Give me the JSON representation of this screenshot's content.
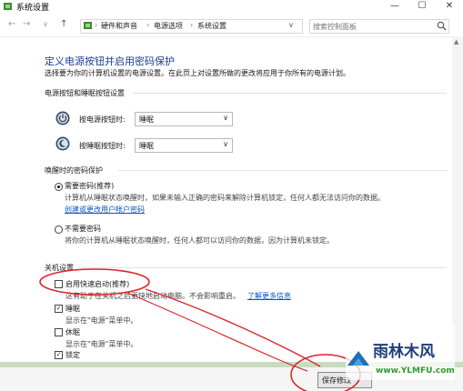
{
  "window": {
    "title": "系统设置",
    "minimize": "—",
    "maximize": "☐",
    "close": "✕"
  },
  "nav": {
    "back": "←",
    "forward": "→",
    "down": "∨",
    "up": "↑",
    "breadcrumbs": [
      "硬件和声音",
      "电源选项",
      "系统设置"
    ],
    "sep": "›",
    "chevron_end": "∨"
  },
  "search": {
    "placeholder": "搜索控制面板"
  },
  "main": {
    "title": "定义电源按钮并启用密码保护",
    "description": "选择要为你的计算机设置的电源设置。在此页上对设置所做的更改将应用于你所有的电源计划。",
    "power_section": {
      "header": "电源按钮和睡眠按钮设置",
      "power_button_label": "按电源按钮时:",
      "power_button_value": "睡眠",
      "sleep_button_label": "按睡眠按钮时:",
      "sleep_button_value": "睡眠"
    },
    "password_section": {
      "header": "唤醒时的密码保护",
      "require_label": "需要密码(推荐)",
      "require_desc": "计算机从睡眠状态唤醒时，如果未输入正确的密码来解除计算机锁定，任何人都无法访问你的数据。",
      "require_link": "创建或更改用户帐户密码",
      "norequire_label": "不需要密码",
      "norequire_desc": "将你的计算机从睡眠状态唤醒时，任何人都可以访问你的数据，因为计算机未锁定。"
    },
    "shutdown_section": {
      "header": "关机设置",
      "fast_startup_label": "启用快速启动(推荐)",
      "fast_startup_desc": "这有助于在关机之后更快地启动电脑。不会影响重启。",
      "fast_startup_link": "了解更多信息",
      "sleep_label": "睡眠",
      "sleep_desc": "显示在\"电源\"菜单中。",
      "hibernate_label": "休眠",
      "hibernate_desc": "显示在\"电源\"菜单中。",
      "lock_label": "锁定",
      "checkmark": "✓"
    }
  },
  "footer": {
    "save_label": "保存修改"
  },
  "watermark": {
    "line1": "雨林木风",
    "line2": "www.YLMFU.com"
  },
  "colors": {
    "title_blue": "#1e3d8f",
    "link_blue": "#0a55c4",
    "annotation_red": "#d9262c",
    "green_bar": "#c9dcbf"
  }
}
